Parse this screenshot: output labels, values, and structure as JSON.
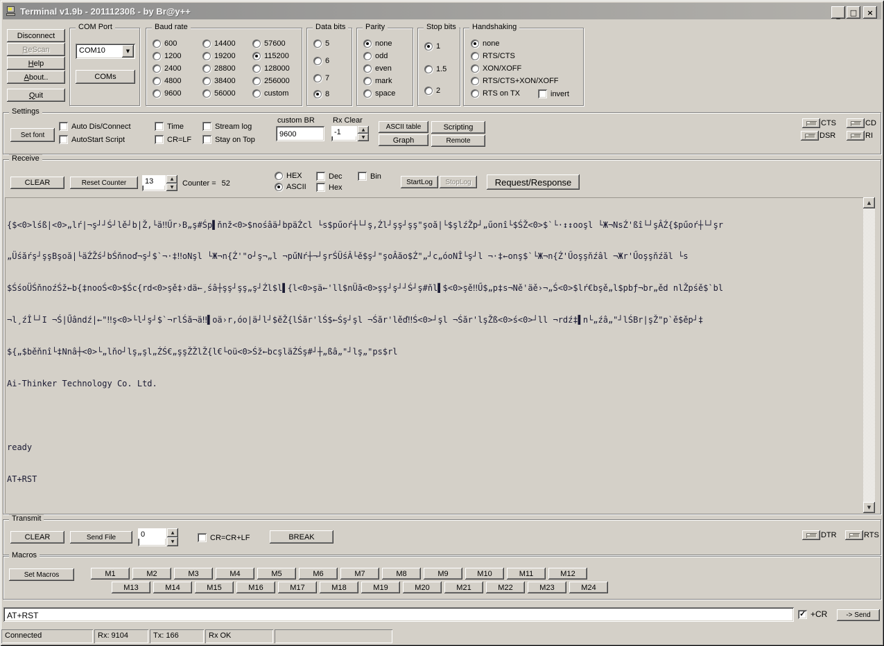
{
  "window": {
    "title": "Terminal v1.9b - 20111230ß - by Br@y++",
    "minimize_glyph": "_",
    "maximize_glyph": "□",
    "close_glyph": "×"
  },
  "connection": {
    "buttons": [
      {
        "label": "Disconnect",
        "disabled": false
      },
      {
        "label": "ReScan",
        "disabled": true
      },
      {
        "label": "Help",
        "disabled": false
      },
      {
        "label": "About..",
        "disabled": false
      },
      {
        "label": "Quit",
        "disabled": false
      }
    ]
  },
  "com_port": {
    "legend": "COM Port",
    "selected": "COM10",
    "coms_label": "COMs"
  },
  "baud": {
    "legend": "Baud rate",
    "options": [
      {
        "label": "600",
        "selected": false
      },
      {
        "label": "1200",
        "selected": false
      },
      {
        "label": "2400",
        "selected": false
      },
      {
        "label": "4800",
        "selected": false
      },
      {
        "label": "9600",
        "selected": false
      },
      {
        "label": "14400",
        "selected": false
      },
      {
        "label": "19200",
        "selected": false
      },
      {
        "label": "28800",
        "selected": false
      },
      {
        "label": "38400",
        "selected": false
      },
      {
        "label": "56000",
        "selected": false
      },
      {
        "label": "57600",
        "selected": false
      },
      {
        "label": "115200",
        "selected": true
      },
      {
        "label": "128000",
        "selected": false
      },
      {
        "label": "256000",
        "selected": false
      },
      {
        "label": "custom",
        "selected": false
      }
    ]
  },
  "data_bits": {
    "legend": "Data bits",
    "options": [
      {
        "label": "5",
        "selected": false
      },
      {
        "label": "6",
        "selected": false
      },
      {
        "label": "7",
        "selected": false
      },
      {
        "label": "8",
        "selected": true
      }
    ]
  },
  "parity": {
    "legend": "Parity",
    "options": [
      {
        "label": "none",
        "selected": true
      },
      {
        "label": "odd",
        "selected": false
      },
      {
        "label": "even",
        "selected": false
      },
      {
        "label": "mark",
        "selected": false
      },
      {
        "label": "space",
        "selected": false
      }
    ]
  },
  "stop_bits": {
    "legend": "Stop bits",
    "options": [
      {
        "label": "1",
        "selected": true
      },
      {
        "label": "1.5",
        "selected": false
      },
      {
        "label": "2",
        "selected": false
      }
    ]
  },
  "handshaking": {
    "legend": "Handshaking",
    "options": [
      {
        "label": "none",
        "selected": true
      },
      {
        "label": "RTS/CTS",
        "selected": false
      },
      {
        "label": "XON/XOFF",
        "selected": false
      },
      {
        "label": "RTS/CTS+XON/XOFF",
        "selected": false
      },
      {
        "label": "RTS on TX",
        "selected": false
      }
    ],
    "invert": {
      "label": "invert",
      "checked": false
    }
  },
  "settings": {
    "legend": "Settings",
    "set_font": "Set font",
    "checkboxes": [
      {
        "label": "Auto Dis/Connect",
        "checked": false
      },
      {
        "label": "AutoStart Script",
        "checked": false
      },
      {
        "label": "Time",
        "checked": false
      },
      {
        "label": "CR=LF",
        "checked": false
      },
      {
        "label": "Stream log",
        "checked": false
      },
      {
        "label": "Stay on Top",
        "checked": false
      }
    ],
    "custom_br": {
      "label": "custom BR",
      "value": "9600"
    },
    "rx_clear": {
      "label": "Rx Clear",
      "value": "-1"
    },
    "buttons": {
      "ascii_table": "ASCII table",
      "scripting": "Scripting",
      "graph": "Graph",
      "remote": "Remote"
    },
    "indicators": [
      "CTS",
      "CD",
      "DSR",
      "RI"
    ]
  },
  "receive": {
    "legend": "Receive",
    "clear": "CLEAR",
    "reset_counter": "Reset Counter",
    "lines_value": "13",
    "counter_label": "Counter =",
    "counter_value": "52",
    "mode": [
      {
        "label": "HEX",
        "selected": false
      },
      {
        "label": "ASCII",
        "selected": true
      }
    ],
    "views": [
      {
        "label": "Dec",
        "checked": false
      },
      {
        "label": "Hex",
        "checked": false
      },
      {
        "label": "Bin",
        "checked": false
      }
    ],
    "startlog": "StartLog",
    "stoplog": "StopLog",
    "reqres": "Request/Response",
    "terminal_lines": [
      "{$<0>lśß|<0>„lŕ|¬ş┘┘Ś┘lě┘b|Ž,└ä‼Űr›B„ş#Śp▌ňnž<0>$nośâä┘bpäŹcl └s$pűoŕ┼└┘ş,Źl┘şş┘şş\"şoă|└$şlźŽp┘„űonî└$ŚŽ<0>$`└·↕↕ooşl └Ж¬NsŹ'ßî└┘şÂŹ{$pűoŕ┼└┘şr",
      "„Üśăŕş┘şşBşoă|└äŹŽś┘bŚňnoď¬ş┘$`¬·‡‼oNşl └Ж¬n{Ź'\"o┘ş¬„l ¬pűNŕ┼¬┘şrŚÜśÂ└ě$ş┘\"şoÂăo$Ź\"„┘c„óoNÎ└ş┘l ¬·‡←onş$`└Ж¬n{Ź'Űoşşňźâl ¬Жr'Űoşşňźăl └s",
      "$ŚśoÜŚňnoźŚž←b{‡nooŚ<0>$Śc{rd<0>şě‡›dä←¸śâ┼şş┘şş„ş┘Źl$l▌{l<0>şä←'ll$nÜă<0>şş┘ş┘┘Ś┘ş#ňl▌$<0>şě‼Ű$„p‡s¬Ně'äě›¬„Ś<0>$lŕ€bşě„l$pbƒ¬br„ěd nlŽpśě$`bl",
      "¬l¸źÎ└┘I ¬Ś|Űândź|←\"‼ş<0>└l┘ş┘$`¬rlŚă¬ä‼▌oä›r,óo|ä┘l┘$ěŽ{lŚăr'lŚ$←Śş┘şl ¬Śăr'lěď‼Ś<0>┘şl ¬Śăr'lşŽß<0>ś<0>┘ll ¬rdź‡▌n└„źâ„\"┘lŚBr|şŽ\"p`ě$ěp┘‡",
      "${„$běňnî└‡Nnâ┼<0>└„lňo┘lş„şl„ŹŚ€„şşŽŽlŽ{l€└oü<0>Śž←bcşläŹŚş#┘┼„ßâ„\"┘lş„\"ps$rl",
      "Ai-Thinker Technology Co. Ltd.",
      "",
      "ready",
      "AT+RST"
    ]
  },
  "transmit": {
    "legend": "Transmit",
    "clear": "CLEAR",
    "send_file": "Send File",
    "spin_value": "0",
    "crlf": {
      "label": "CR=CR+LF",
      "checked": false
    },
    "break_label": "BREAK",
    "indicators": [
      "DTR",
      "RTS"
    ]
  },
  "macros": {
    "legend": "Macros",
    "set_label": "Set Macros",
    "row1": [
      "M1",
      "M2",
      "M3",
      "M4",
      "M5",
      "M6",
      "M7",
      "M8",
      "M9",
      "M10",
      "M11",
      "M12"
    ],
    "row2": [
      "M13",
      "M14",
      "M15",
      "M16",
      "M17",
      "M18",
      "M19",
      "M20",
      "M21",
      "M22",
      "M23",
      "M24"
    ]
  },
  "send": {
    "value": "AT+RST",
    "cr": {
      "label": "+CR",
      "checked": true
    },
    "send_label": "-> Send"
  },
  "statusbar": {
    "panels": [
      "Connected",
      "Rx: 9104",
      "Tx: 166",
      "Rx OK",
      ""
    ]
  }
}
